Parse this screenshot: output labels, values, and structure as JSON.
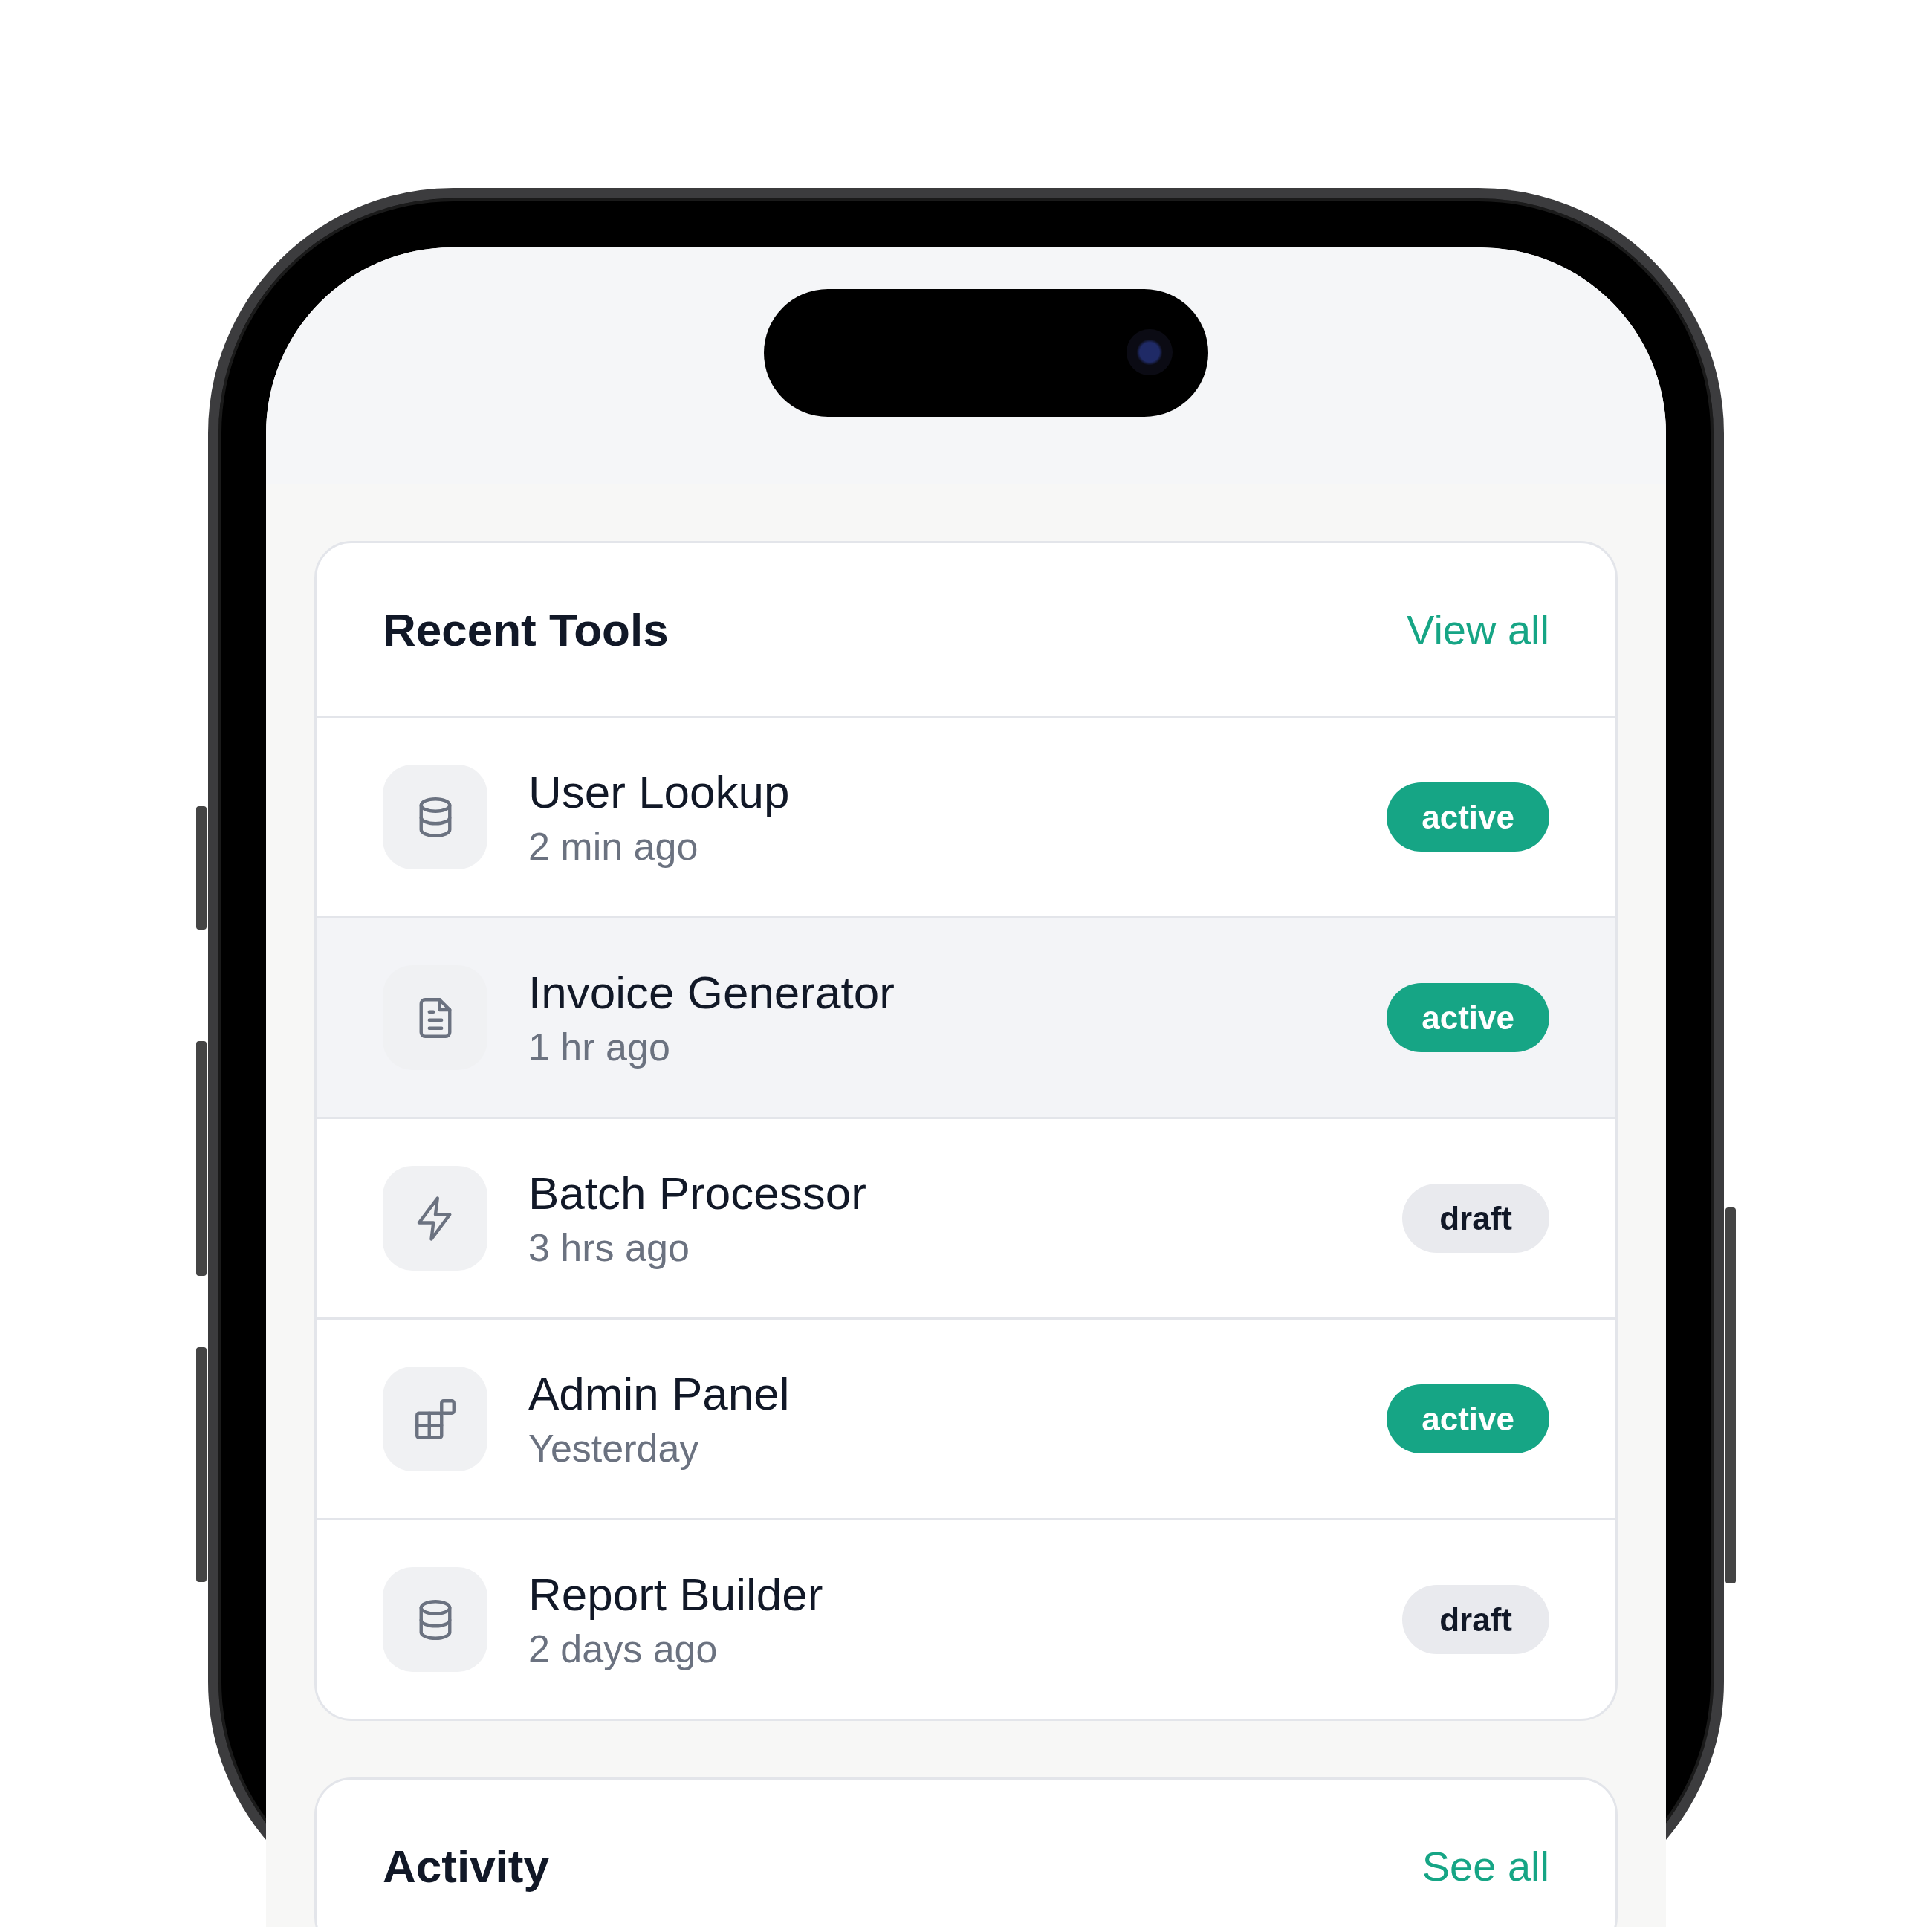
{
  "sections": [
    {
      "title": "Recent Tools",
      "link": "View all",
      "items": [
        {
          "name": "User Lookup",
          "time": "2 min ago",
          "kind": "database",
          "badge": {
            "label": "active",
            "kind": "active"
          },
          "selected": false
        },
        {
          "name": "Invoice Generator",
          "time": "1 hr ago",
          "kind": "document",
          "badge": {
            "label": "active",
            "kind": "active"
          },
          "selected": true
        },
        {
          "name": "Batch Processor",
          "time": "3 hrs ago",
          "kind": "bolt",
          "badge": {
            "label": "draft",
            "kind": "draft"
          },
          "selected": false
        },
        {
          "name": "Admin Panel",
          "time": "Yesterday",
          "kind": "widgets",
          "badge": {
            "label": "active",
            "kind": "active"
          },
          "selected": false
        },
        {
          "name": "Report Builder",
          "time": "2 days ago",
          "kind": "database",
          "badge": {
            "label": "draft",
            "kind": "draft"
          },
          "selected": false
        }
      ]
    },
    {
      "title": "Activity",
      "link": "See all"
    }
  ]
}
